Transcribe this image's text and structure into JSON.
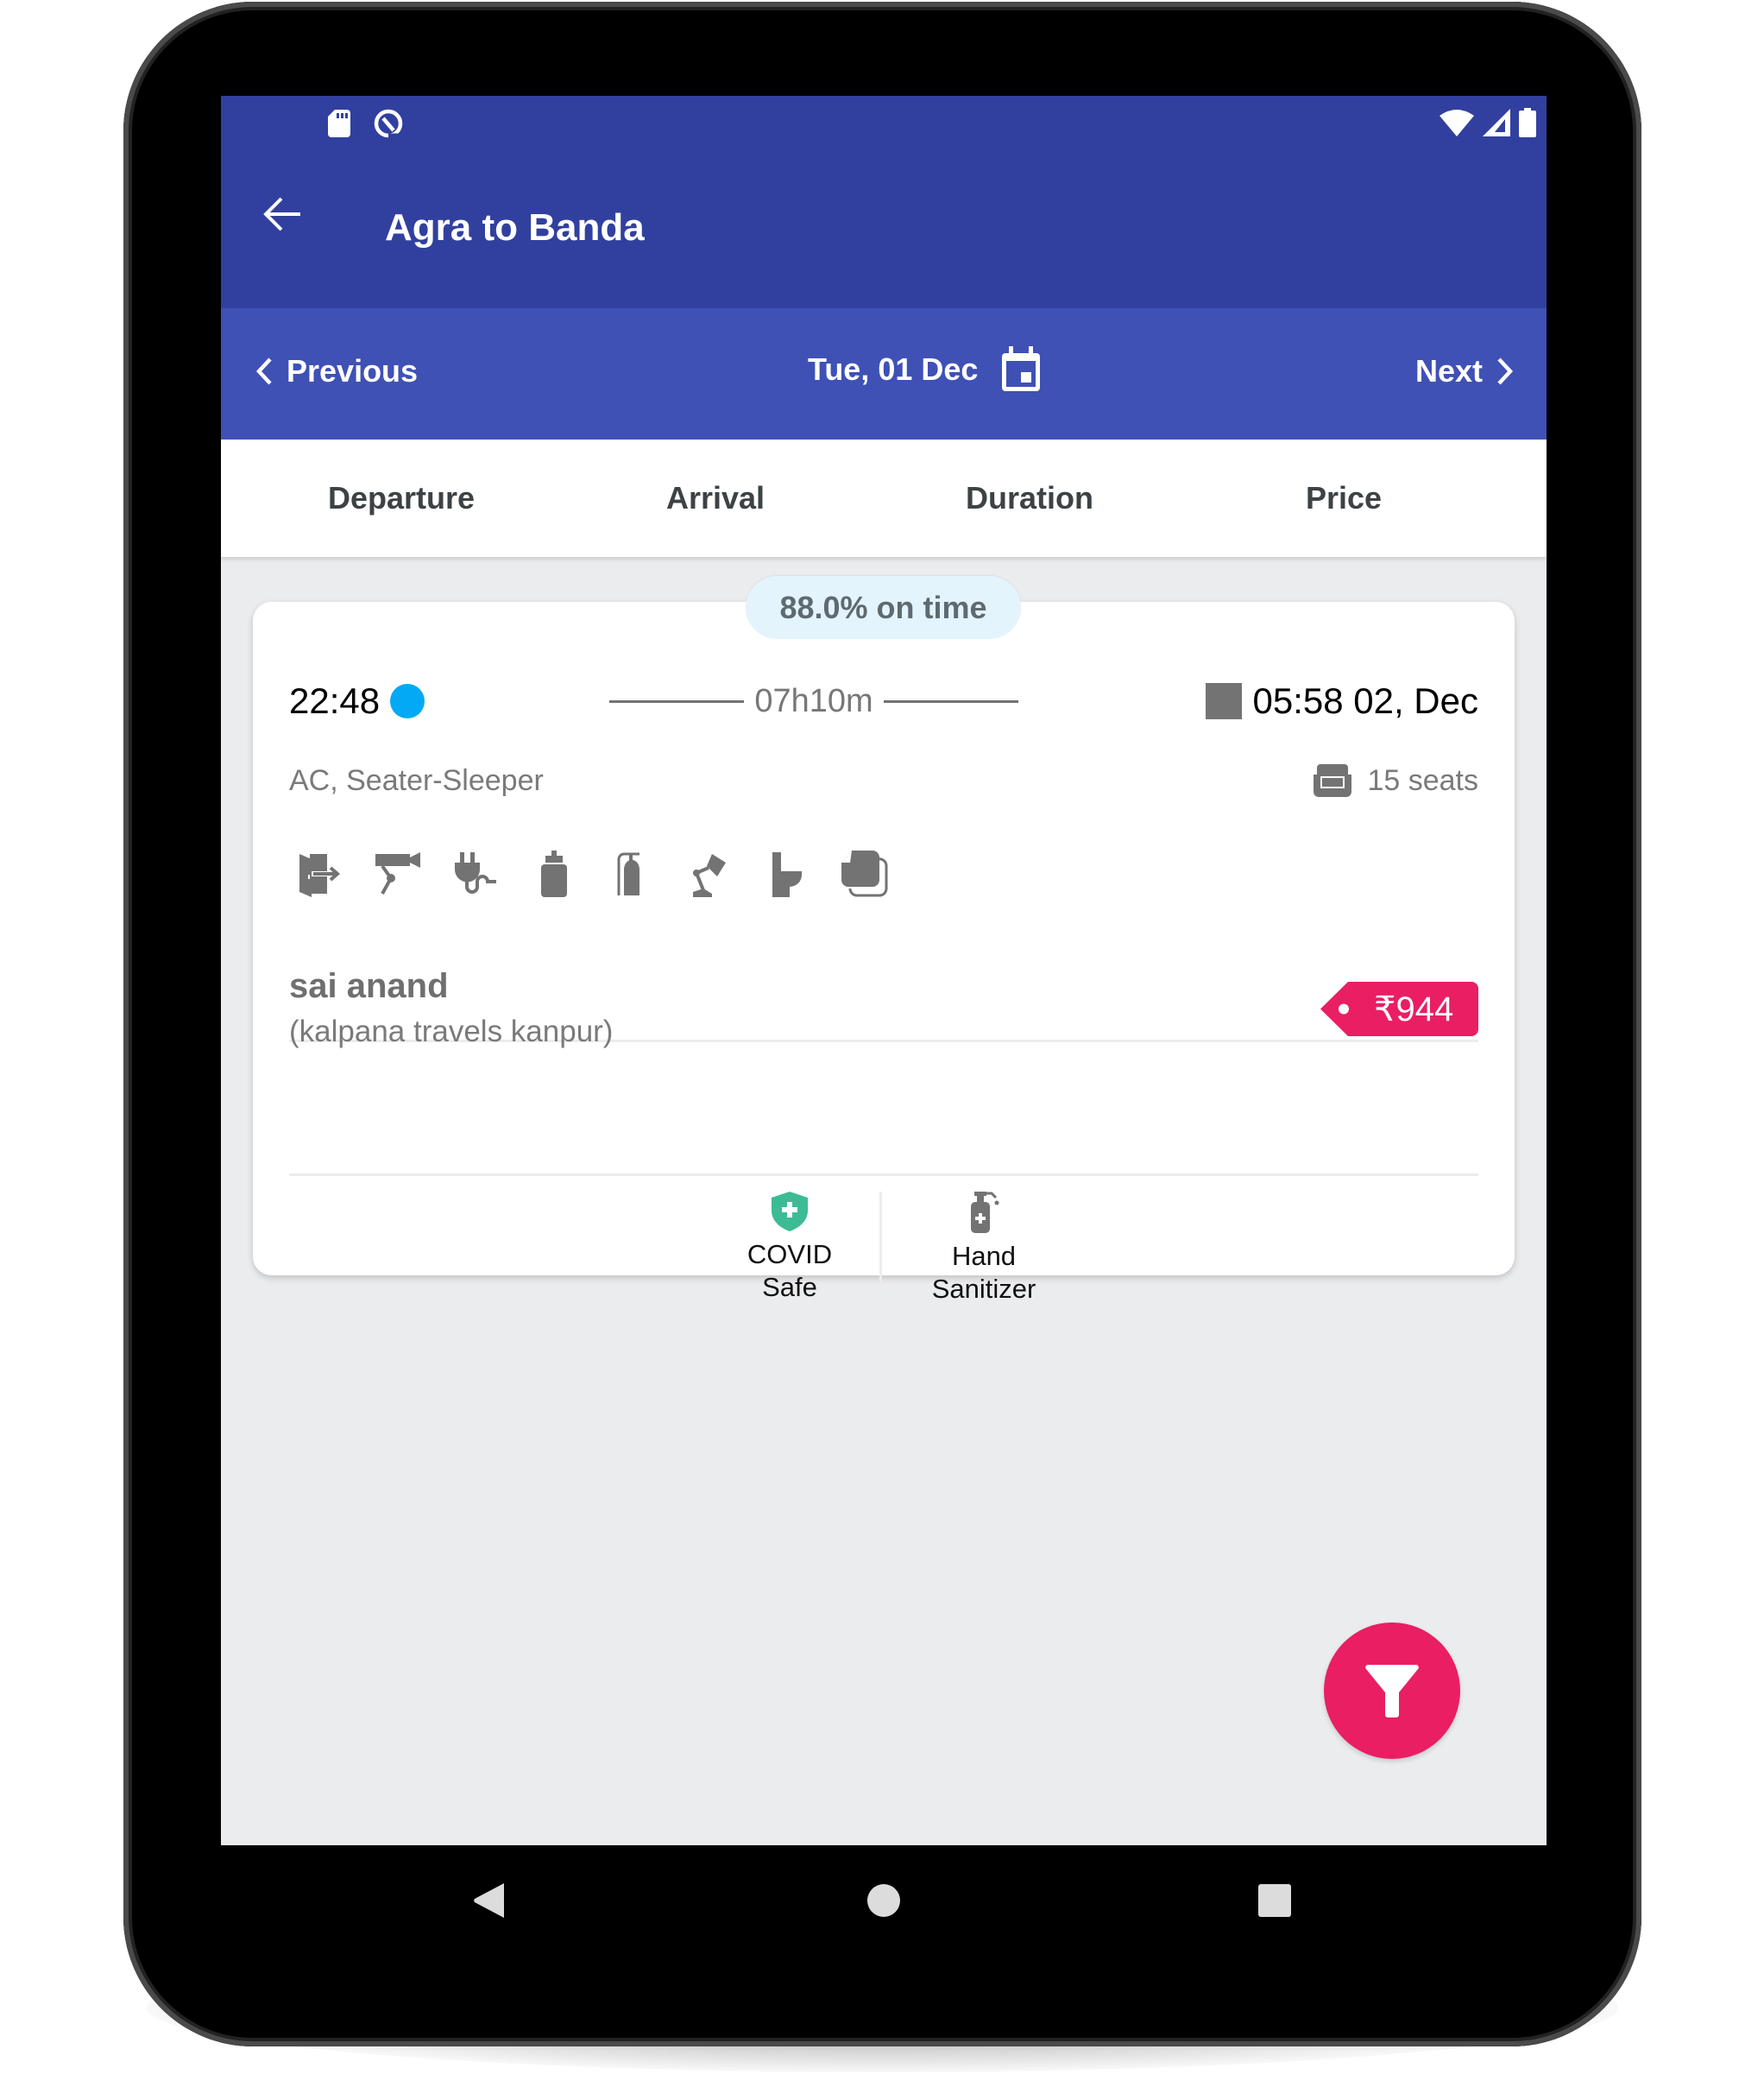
{
  "status_bar": {
    "left_icons": [
      "sd-card-icon",
      "android-q-icon"
    ],
    "right_icons": [
      "wifi-icon",
      "signal-icon",
      "battery-icon"
    ]
  },
  "toolbar": {
    "back_icon": "arrow-left-icon",
    "title": "Agra to Banda"
  },
  "date_nav": {
    "previous_label": "Previous",
    "date_label": "Tue, 01 Dec",
    "next_label": "Next",
    "calendar_icon": "calendar-icon"
  },
  "sort_tabs": [
    {
      "label": "Departure"
    },
    {
      "label": "Arrival"
    },
    {
      "label": "Duration"
    },
    {
      "label": "Price"
    }
  ],
  "results": [
    {
      "on_time": "88.0% on time",
      "departure_time": "22:48",
      "duration": "07h10m",
      "arrival_time": "05:58 02, Dec",
      "bus_type": "AC, Seater-Sleeper",
      "seats": "15 seats",
      "amenities": [
        "emergency-exit-icon",
        "cctv-icon",
        "charging-point-icon",
        "water-bottle-icon",
        "fire-extinguisher-icon",
        "reading-light-icon",
        "toilet-icon",
        "blanket-icon"
      ],
      "operator_name": "sai anand",
      "operator_company": "(kalpana travels kanpur)",
      "price": "₹944",
      "safety_features": [
        {
          "label_line1": "COVID",
          "label_line2": "Safe",
          "icon": "shield-plus-icon"
        },
        {
          "label_line1": "Hand",
          "label_line2": "Sanitizer",
          "icon": "hand-sanitizer-icon"
        }
      ]
    }
  ],
  "fab": {
    "icon": "filter-icon"
  },
  "nav_bar": {
    "back": "nav-back-icon",
    "home": "nav-home-icon",
    "recents": "nav-recents-icon"
  },
  "colors": {
    "toolbar": "#31409e",
    "date_bar": "#3f51b5",
    "accent": "#e91e63",
    "departure_dot": "#03a9f4",
    "on_time_pill": "#e3f4fd",
    "covid_shield": "#3dbb95"
  }
}
